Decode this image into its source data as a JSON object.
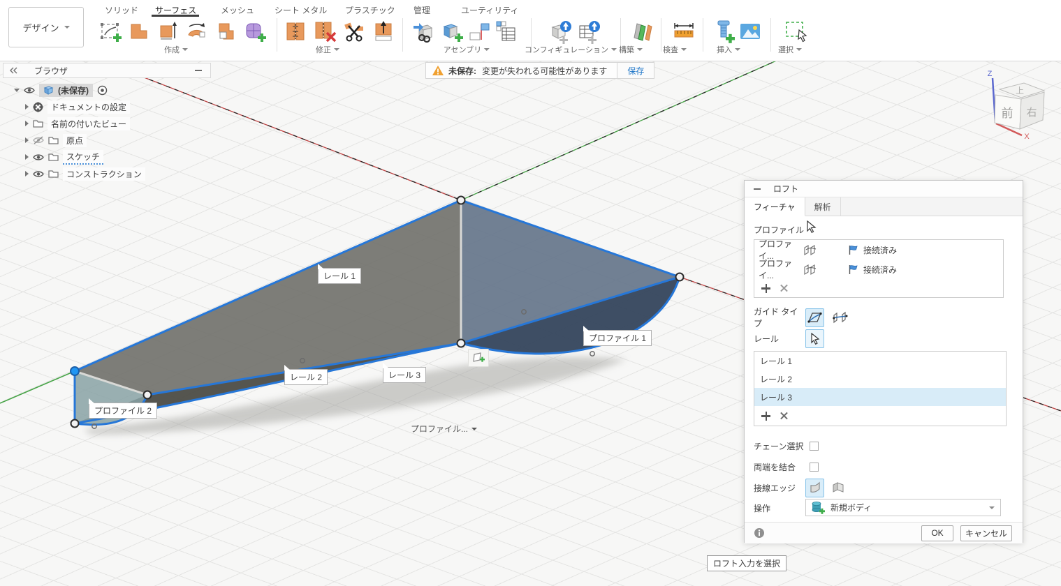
{
  "app": {
    "design_label": "デザイン",
    "tabs": [
      "ソリッド",
      "サーフェス",
      "メッシュ",
      "シート メタル",
      "プラスチック",
      "管理",
      "ユーティリティ"
    ],
    "active_tab": "サーフェス",
    "groups": {
      "create": "作成",
      "modify": "修正",
      "assemble": "アセンブリ",
      "configure": "コンフィギュレーション",
      "construct": "構築",
      "inspect": "検査",
      "insert": "挿入",
      "select": "選択"
    }
  },
  "browser": {
    "title": "ブラウザ",
    "items": [
      {
        "label": "(未保存)"
      },
      {
        "label": "ドキュメントの設定"
      },
      {
        "label": "名前の付いたビュー"
      },
      {
        "label": "原点"
      },
      {
        "label": "スケッチ"
      },
      {
        "label": "コンストラクション"
      }
    ]
  },
  "warning": {
    "label": "未保存:",
    "message": "変更が失われる可能性があります",
    "action": "保存"
  },
  "viewport": {
    "labels": {
      "rail1": "レール 1",
      "rail2": "レール 2",
      "rail3": "レール 3",
      "profile1": "プロファイル 1",
      "profile2": "プロファイル 2",
      "profiles_dropdown": "プロファイル..."
    },
    "status_tooltip": "ロフト入力を選択",
    "viewcube": {
      "front": "前",
      "right": "右",
      "top": "上",
      "axis_x": "X",
      "axis_z": "Z"
    }
  },
  "dialog": {
    "title": "ロフト",
    "tabs": [
      "フィーチャ",
      "解析"
    ],
    "profile_label": "プロファイル",
    "profiles": [
      {
        "name": "プロファイ...",
        "status": "接続済み"
      },
      {
        "name": "プロファイ...",
        "status": "接続済み"
      }
    ],
    "guide_type_label": "ガイド タイプ",
    "rail_label": "レール",
    "rails": [
      "レール 1",
      "レール 2",
      "レール 3"
    ],
    "selected_rail_index": 2,
    "chain_label": "チェーン選択",
    "join_ends_label": "両端を結合",
    "tangent_label": "接線エッジ",
    "operation_label": "操作",
    "operation_value": "新規ボディ",
    "ok_label": "OK",
    "cancel_label": "キャンセル"
  },
  "colors": {
    "edge_blue": "#2677d8",
    "selection_bg": "#d8ecf8",
    "axis_red": "#c04545",
    "axis_green": "#47a447",
    "warning_orange": "#f0a030"
  }
}
